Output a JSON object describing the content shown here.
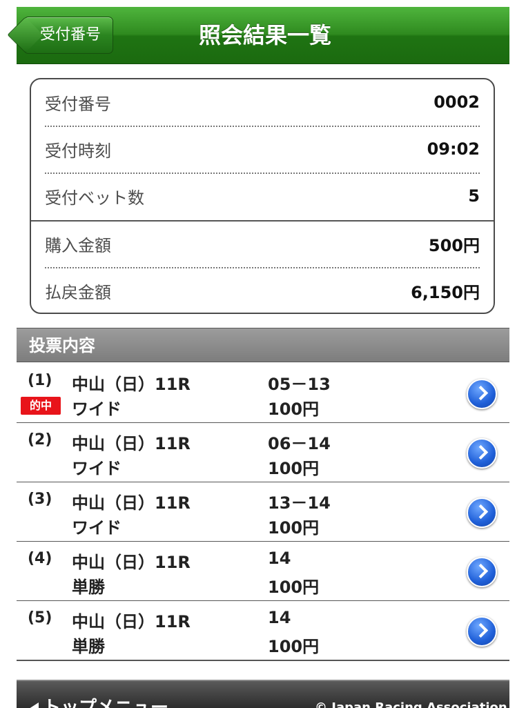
{
  "header": {
    "back_label": "受付番号",
    "title": "照会結果一覧"
  },
  "info": [
    {
      "label": "受付番号",
      "value": "0002"
    },
    {
      "label": "受付時刻",
      "value": "09:02"
    },
    {
      "label": "受付ベット数",
      "value": "5"
    },
    {
      "label": "購入金額",
      "value": "500円"
    },
    {
      "label": "払戻金額",
      "value": "6,150円"
    }
  ],
  "section_title": "投票内容",
  "hit_badge": "的中",
  "bets": [
    {
      "num": "(1)",
      "race": "中山（日）11R",
      "kind": "ワイド",
      "combo": "05－13",
      "amount": "100円",
      "hit": true
    },
    {
      "num": "(2)",
      "race": "中山（日）11R",
      "kind": "ワイド",
      "combo": "06－14",
      "amount": "100円",
      "hit": false
    },
    {
      "num": "(3)",
      "race": "中山（日）11R",
      "kind": "ワイド",
      "combo": "13－14",
      "amount": "100円",
      "hit": false
    },
    {
      "num": "(4)",
      "race": "中山（日）11R",
      "kind": "単勝",
      "combo": "14",
      "amount": "100円",
      "hit": false
    },
    {
      "num": "(5)",
      "race": "中山（日）11R",
      "kind": "単勝",
      "combo": "14",
      "amount": "100円",
      "hit": false
    }
  ],
  "footer": {
    "top_menu": "トップメニュー",
    "copyright": "© Japan Racing Association"
  },
  "colors": {
    "header_green": "#2f8a1f",
    "hit_red": "#e8141a",
    "chevron_blue": "#1f5fd8"
  }
}
